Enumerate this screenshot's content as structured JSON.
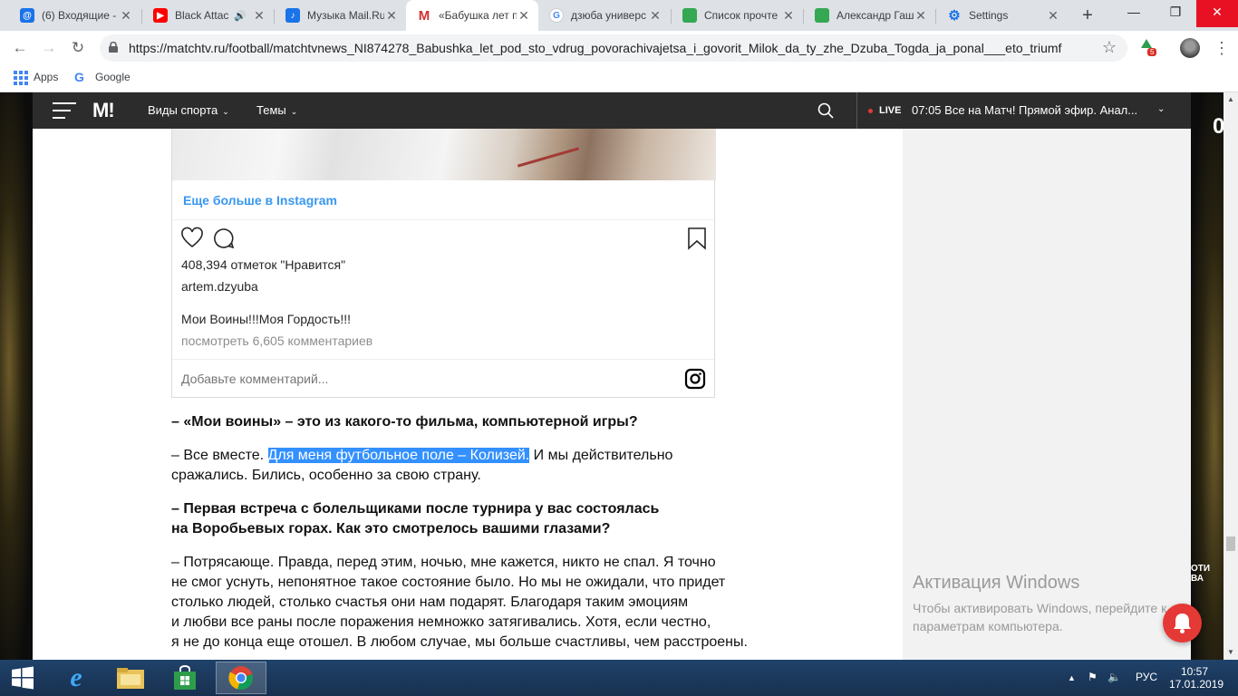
{
  "browser": {
    "tabs": [
      {
        "title": "(6) Входящие - ",
        "favicon": "mail-at-icon",
        "color": "#1a73e8"
      },
      {
        "title": "Black Attac",
        "favicon": "youtube-icon",
        "color": "#ff0000",
        "audio": true
      },
      {
        "title": "Музыка Mail.Ru",
        "favicon": "mail-music-icon",
        "color": "#1a73e8"
      },
      {
        "title": "«Бабушка лет п",
        "favicon": "matchtv-icon",
        "color": "#d32f2f",
        "active": true
      },
      {
        "title": "дзюба универс",
        "favicon": "google-icon",
        "color": "#4285f4"
      },
      {
        "title": "Список прочте",
        "favicon": "sheets-icon",
        "color": "#34a853"
      },
      {
        "title": "Александр Гаш",
        "favicon": "sheets-icon",
        "color": "#34a853"
      },
      {
        "title": "Settings",
        "favicon": "settings-gear-icon",
        "color": "#1a73e8"
      }
    ],
    "url": "https://matchtv.ru/football/matchtvnews_NI874278_Babushka_let_pod_sto_vdrug_povorachivajetsa_i_govorit_Milok_da_ty_zhe_Dzuba_Togda_ja_ponal___eto_triumf",
    "extension_badge": "5",
    "bookmarks": [
      {
        "label": "Apps",
        "icon": "apps-grid-icon"
      },
      {
        "label": "Google",
        "icon": "google-icon"
      }
    ]
  },
  "site": {
    "logo": "M!",
    "nav": [
      "Виды спорта",
      "Темы"
    ],
    "live_label": "LIVE",
    "live_text": "07:05 Все на Матч! Прямой эфир. Анал...",
    "right_zero": "0",
    "right_text": "ОТИ\nВА"
  },
  "instagram": {
    "more_link": "Еще больше в Instagram",
    "likes": "408,394 отметок \"Нравится\"",
    "username": "artem.dzyuba",
    "caption": "Мои Воины!!!Моя Гордость!!!",
    "comments_link": "посмотреть 6,605 комментариев",
    "comment_placeholder": "Добавьте комментарий..."
  },
  "article": {
    "q1": "– «Мои воины» – это из какого-то фильма, компьютерной игры?",
    "a1_pre": "– Все вместе. ",
    "a1_highlight": "Для меня футбольное поле – Колизей.",
    "a1_post": " И мы действительно",
    "a1_line2": "сражались. Бились, особенно за свою страну.",
    "q2_line1": "– Первая встреча с болельщиками после турнира у вас состоялась",
    "q2_line2": "на Воробьевых горах. Как это смотрелось вашими глазами?",
    "a2_lines": [
      "– Потрясающе. Правда, перед этим, ночью, мне кажется, никто не спал. Я точно",
      "не смог уснуть, непонятное такое состояние было. Но мы не ожидали, что придет",
      "столько людей, столько счастья они нам подарят. Благодаря таким эмоциям",
      "и любви все раны после поражения немножко затягивались. Хотя, если честно,",
      "я не до конца еще отошел. В любом случае, мы больше счастливы, чем расстроены."
    ]
  },
  "watermark": {
    "title": "Активация Windows",
    "line1": "Чтобы активировать Windows, перейдите к",
    "line2": "параметрам компьютера."
  },
  "taskbar": {
    "apps": [
      "windows-start-icon",
      "internet-explorer-icon",
      "file-explorer-icon",
      "store-icon",
      "chrome-icon"
    ],
    "lang": "РУС",
    "time": "10:57",
    "date": "17.01.2019"
  },
  "colors": {
    "accent_blue": "#3897f0",
    "site_header": "#2c2c2c",
    "live_red": "#e53935",
    "selection": "#3390ff"
  }
}
